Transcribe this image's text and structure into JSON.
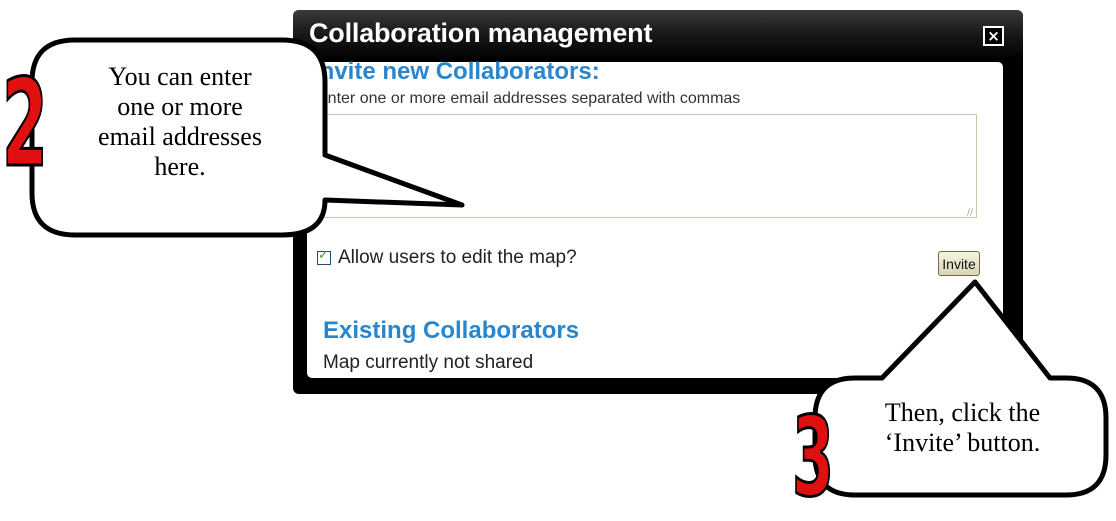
{
  "dialog": {
    "title": "Collaboration management",
    "close_icon_glyph": "×",
    "invite_heading": "Invite new Collaborators:",
    "email_hint": "Enter one or more email addresses separated with commas",
    "email_value": "",
    "resize_grip_glyph": "//",
    "allow_edit_label": "Allow users to edit the map?",
    "allow_edit_checked": true,
    "invite_button_label": "Invite",
    "existing_heading": "Existing Collaborators",
    "existing_status": "Map currently not shared"
  },
  "callouts": [
    {
      "step": "2",
      "lines": [
        "You can enter",
        "one or more",
        "email addresses",
        "here."
      ]
    },
    {
      "step": "3",
      "lines": [
        "Then, click the",
        "‘Invite’ button."
      ]
    }
  ],
  "colors": {
    "heading_blue": "#2a86cc",
    "step_number_red": "#e01010",
    "dialog_frame": "#000000"
  }
}
